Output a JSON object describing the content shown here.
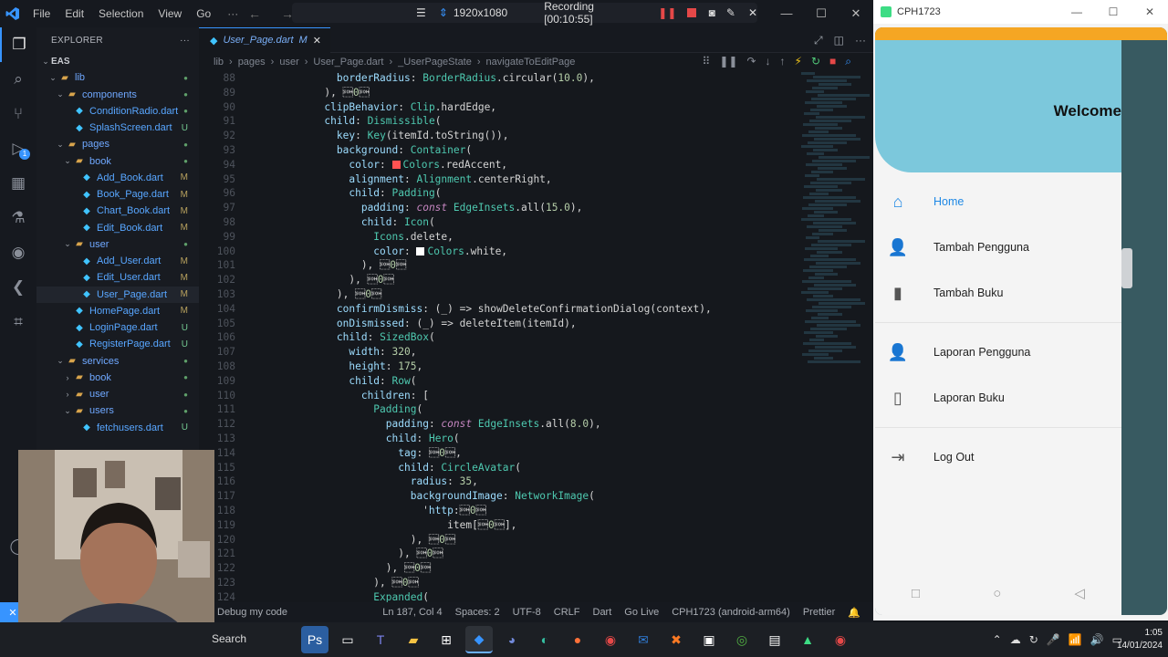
{
  "vscode": {
    "menu": [
      "File",
      "Edit",
      "Selection",
      "View",
      "Go"
    ],
    "more": "···",
    "recording": {
      "resolution": "1920x1080",
      "status": "Recording [00:10:55]"
    },
    "explorer_title": "EXPLORER",
    "workspace": "EAS",
    "tree": [
      {
        "label": "lib",
        "type": "folder",
        "depth": 1,
        "status": "dot"
      },
      {
        "label": "components",
        "type": "folder",
        "depth": 2,
        "status": "dot"
      },
      {
        "label": "ConditionRadio.dart",
        "type": "file",
        "depth": 3,
        "status": "dot"
      },
      {
        "label": "SplashScreen.dart",
        "type": "file",
        "depth": 3,
        "status": "U"
      },
      {
        "label": "pages",
        "type": "folder",
        "depth": 2,
        "status": "dot"
      },
      {
        "label": "book",
        "type": "folder",
        "depth": 3,
        "status": "dot"
      },
      {
        "label": "Add_Book.dart",
        "type": "file",
        "depth": 4,
        "status": "M"
      },
      {
        "label": "Book_Page.dart",
        "type": "file",
        "depth": 4,
        "status": "M"
      },
      {
        "label": "Chart_Book.dart",
        "type": "file",
        "depth": 4,
        "status": "M"
      },
      {
        "label": "Edit_Book.dart",
        "type": "file",
        "depth": 4,
        "status": "M"
      },
      {
        "label": "user",
        "type": "folder",
        "depth": 3,
        "status": "dot"
      },
      {
        "label": "Add_User.dart",
        "type": "file",
        "depth": 4,
        "status": "M"
      },
      {
        "label": "Edit_User.dart",
        "type": "file",
        "depth": 4,
        "status": "M"
      },
      {
        "label": "User_Page.dart",
        "type": "file",
        "depth": 4,
        "status": "M",
        "selected": true
      },
      {
        "label": "HomePage.dart",
        "type": "file",
        "depth": 3,
        "status": "M"
      },
      {
        "label": "LoginPage.dart",
        "type": "file",
        "depth": 3,
        "status": "U"
      },
      {
        "label": "RegisterPage.dart",
        "type": "file",
        "depth": 3,
        "status": "U"
      },
      {
        "label": "services",
        "type": "folder",
        "depth": 2,
        "status": "dot"
      },
      {
        "label": "book",
        "type": "folder-closed",
        "depth": 3,
        "status": "dot"
      },
      {
        "label": "user",
        "type": "folder-closed",
        "depth": 3,
        "status": "dot"
      },
      {
        "label": "users",
        "type": "folder",
        "depth": 3,
        "status": "dot"
      },
      {
        "label": "fetchusers.dart",
        "type": "file",
        "depth": 4,
        "status": "U"
      }
    ],
    "tab": {
      "label": "User_Page.dart",
      "status": "M"
    },
    "breadcrumbs": [
      "lib",
      "pages",
      "user",
      "User_Page.dart",
      "_UserPageState",
      "navigateToEditPage"
    ],
    "code_first_line": 88,
    "code": [
      "        borderRadius: BorderRadius.circular(10.0),",
      "      ), // RoundedRectangleBorder",
      "      clipBehavior: Clip.hardEdge,",
      "      child: Dismissible(",
      "        key: Key(itemId.toString()),",
      "        background: Container(",
      "          color: Colors.redAccent,",
      "          alignment: Alignment.centerRight,",
      "          child: Padding(",
      "            padding: const EdgeInsets.all(15.0),",
      "            child: Icon(",
      "              Icons.delete,",
      "              color: Colors.white,",
      "            ), // Icon",
      "          ), // Padding",
      "        ), // Container",
      "        confirmDismiss: (_) => showDeleteConfirmationDialog(context),",
      "        onDismissed: (_) => deleteItem(itemId),",
      "        child: SizedBox(",
      "          width: 320,",
      "          height: 175,",
      "          child: Row(",
      "            children: [",
      "              Padding(",
      "                padding: const EdgeInsets.all(8.0),",
      "                child: Hero(",
      "                  tag: 'photo_$itemId',",
      "                  child: CircleAvatar(",
      "                    radius: 35,",
      "                    backgroundImage: NetworkImage(",
      "                      'http://192.168.1.4:8080/eas/pengguna/images/' +",
      "                          item['foto'],",
      "                    ), // NetworkImage",
      "                  ), // CircleAvatar",
      "                ), // Hero",
      "              ), // Padding",
      "              Expanded(",
      "                child: Row("
    ],
    "statusbar": {
      "left": "Debug my code",
      "position": "Ln 187, Col 4",
      "spaces": "Spaces: 2",
      "encoding": "UTF-8",
      "eol": "CRLF",
      "lang": "Dart",
      "golive": "Go Live",
      "device": "CPH1723 (android-arm64)",
      "prettier": "Prettier"
    }
  },
  "emulator": {
    "window_title": "CPH1723",
    "drawer_title": "Welcome",
    "items": [
      {
        "label": "Home",
        "icon": "home-icon",
        "active": true
      },
      {
        "label": "Tambah Pengguna",
        "icon": "person-add-icon"
      },
      {
        "label": "Tambah Buku",
        "icon": "book-add-icon"
      },
      {
        "label": "Laporan Pengguna",
        "icon": "person-search-icon"
      },
      {
        "label": "Laporan Buku",
        "icon": "book-report-icon"
      },
      {
        "label": "Log Out",
        "icon": "logout-icon"
      }
    ]
  },
  "taskbar": {
    "search": "Search",
    "time": "1:05",
    "date": "14/01/2024",
    "colors": {
      "accent": "#3794ff",
      "header": "#7cc8dc",
      "active_item": "#1e88e5"
    }
  }
}
